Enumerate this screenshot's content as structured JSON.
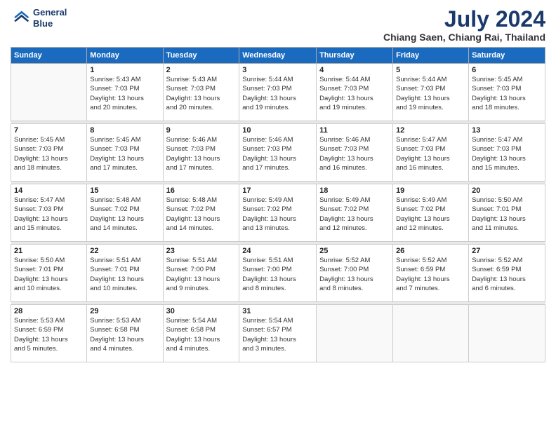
{
  "header": {
    "logo_line1": "General",
    "logo_line2": "Blue",
    "title": "July 2024",
    "subtitle": "Chiang Saen, Chiang Rai, Thailand"
  },
  "calendar": {
    "days_of_week": [
      "Sunday",
      "Monday",
      "Tuesday",
      "Wednesday",
      "Thursday",
      "Friday",
      "Saturday"
    ],
    "weeks": [
      [
        {
          "day": "",
          "info": ""
        },
        {
          "day": "1",
          "info": "Sunrise: 5:43 AM\nSunset: 7:03 PM\nDaylight: 13 hours\nand 20 minutes."
        },
        {
          "day": "2",
          "info": "Sunrise: 5:43 AM\nSunset: 7:03 PM\nDaylight: 13 hours\nand 20 minutes."
        },
        {
          "day": "3",
          "info": "Sunrise: 5:44 AM\nSunset: 7:03 PM\nDaylight: 13 hours\nand 19 minutes."
        },
        {
          "day": "4",
          "info": "Sunrise: 5:44 AM\nSunset: 7:03 PM\nDaylight: 13 hours\nand 19 minutes."
        },
        {
          "day": "5",
          "info": "Sunrise: 5:44 AM\nSunset: 7:03 PM\nDaylight: 13 hours\nand 19 minutes."
        },
        {
          "day": "6",
          "info": "Sunrise: 5:45 AM\nSunset: 7:03 PM\nDaylight: 13 hours\nand 18 minutes."
        }
      ],
      [
        {
          "day": "7",
          "info": "Sunrise: 5:45 AM\nSunset: 7:03 PM\nDaylight: 13 hours\nand 18 minutes."
        },
        {
          "day": "8",
          "info": "Sunrise: 5:45 AM\nSunset: 7:03 PM\nDaylight: 13 hours\nand 17 minutes."
        },
        {
          "day": "9",
          "info": "Sunrise: 5:46 AM\nSunset: 7:03 PM\nDaylight: 13 hours\nand 17 minutes."
        },
        {
          "day": "10",
          "info": "Sunrise: 5:46 AM\nSunset: 7:03 PM\nDaylight: 13 hours\nand 17 minutes."
        },
        {
          "day": "11",
          "info": "Sunrise: 5:46 AM\nSunset: 7:03 PM\nDaylight: 13 hours\nand 16 minutes."
        },
        {
          "day": "12",
          "info": "Sunrise: 5:47 AM\nSunset: 7:03 PM\nDaylight: 13 hours\nand 16 minutes."
        },
        {
          "day": "13",
          "info": "Sunrise: 5:47 AM\nSunset: 7:03 PM\nDaylight: 13 hours\nand 15 minutes."
        }
      ],
      [
        {
          "day": "14",
          "info": "Sunrise: 5:47 AM\nSunset: 7:03 PM\nDaylight: 13 hours\nand 15 minutes."
        },
        {
          "day": "15",
          "info": "Sunrise: 5:48 AM\nSunset: 7:02 PM\nDaylight: 13 hours\nand 14 minutes."
        },
        {
          "day": "16",
          "info": "Sunrise: 5:48 AM\nSunset: 7:02 PM\nDaylight: 13 hours\nand 14 minutes."
        },
        {
          "day": "17",
          "info": "Sunrise: 5:49 AM\nSunset: 7:02 PM\nDaylight: 13 hours\nand 13 minutes."
        },
        {
          "day": "18",
          "info": "Sunrise: 5:49 AM\nSunset: 7:02 PM\nDaylight: 13 hours\nand 12 minutes."
        },
        {
          "day": "19",
          "info": "Sunrise: 5:49 AM\nSunset: 7:02 PM\nDaylight: 13 hours\nand 12 minutes."
        },
        {
          "day": "20",
          "info": "Sunrise: 5:50 AM\nSunset: 7:01 PM\nDaylight: 13 hours\nand 11 minutes."
        }
      ],
      [
        {
          "day": "21",
          "info": "Sunrise: 5:50 AM\nSunset: 7:01 PM\nDaylight: 13 hours\nand 10 minutes."
        },
        {
          "day": "22",
          "info": "Sunrise: 5:51 AM\nSunset: 7:01 PM\nDaylight: 13 hours\nand 10 minutes."
        },
        {
          "day": "23",
          "info": "Sunrise: 5:51 AM\nSunset: 7:00 PM\nDaylight: 13 hours\nand 9 minutes."
        },
        {
          "day": "24",
          "info": "Sunrise: 5:51 AM\nSunset: 7:00 PM\nDaylight: 13 hours\nand 8 minutes."
        },
        {
          "day": "25",
          "info": "Sunrise: 5:52 AM\nSunset: 7:00 PM\nDaylight: 13 hours\nand 8 minutes."
        },
        {
          "day": "26",
          "info": "Sunrise: 5:52 AM\nSunset: 6:59 PM\nDaylight: 13 hours\nand 7 minutes."
        },
        {
          "day": "27",
          "info": "Sunrise: 5:52 AM\nSunset: 6:59 PM\nDaylight: 13 hours\nand 6 minutes."
        }
      ],
      [
        {
          "day": "28",
          "info": "Sunrise: 5:53 AM\nSunset: 6:59 PM\nDaylight: 13 hours\nand 5 minutes."
        },
        {
          "day": "29",
          "info": "Sunrise: 5:53 AM\nSunset: 6:58 PM\nDaylight: 13 hours\nand 4 minutes."
        },
        {
          "day": "30",
          "info": "Sunrise: 5:54 AM\nSunset: 6:58 PM\nDaylight: 13 hours\nand 4 minutes."
        },
        {
          "day": "31",
          "info": "Sunrise: 5:54 AM\nSunset: 6:57 PM\nDaylight: 13 hours\nand 3 minutes."
        },
        {
          "day": "",
          "info": ""
        },
        {
          "day": "",
          "info": ""
        },
        {
          "day": "",
          "info": ""
        }
      ]
    ]
  }
}
